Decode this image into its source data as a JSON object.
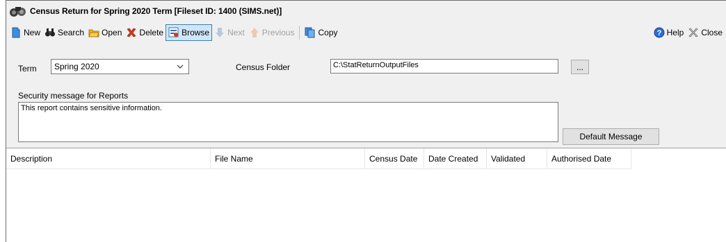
{
  "window": {
    "title": "Census Return for Spring 2020 Term [Fileset ID:  1400 (SIMS.net)]"
  },
  "toolbar": {
    "new_label": "New",
    "search_label": "Search",
    "open_label": "Open",
    "delete_label": "Delete",
    "browse_label": "Browse",
    "next_label": "Next",
    "previous_label": "Previous",
    "copy_label": "Copy",
    "help_label": "Help",
    "close_label": "Close"
  },
  "form": {
    "term_label": "Term",
    "term_value": "Spring 2020",
    "census_folder_label": "Census Folder",
    "census_folder_value": "C:\\StatReturnOutputFiles",
    "browse_folder_label": "...",
    "security_label": "Security message for Reports",
    "security_value": "This report contains sensitive information.",
    "default_message_label": "Default Message"
  },
  "grid": {
    "columns": [
      "Description",
      "File Name",
      "Census Date",
      "Date Created",
      "Validated",
      "Authorised Date"
    ],
    "rows": []
  },
  "colors": {
    "window_bg": "#f0f0f0",
    "active_button_bg": "#cfe6f8",
    "active_button_border": "#3c7fb1",
    "delete_red": "#d03a1a",
    "folder_orange": "#f0b030",
    "help_blue": "#2a6fd0"
  }
}
